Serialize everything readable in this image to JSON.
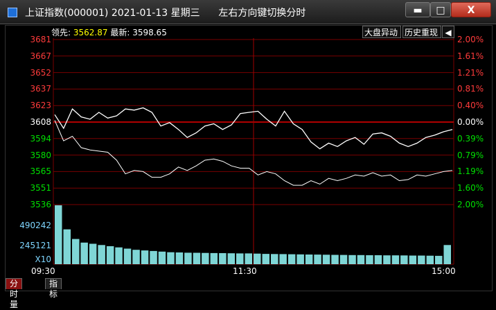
{
  "window": {
    "title": "上证指数(000001) 2021-01-13 星期三      左右方向键切换分时",
    "buttons": {
      "minimize": "▬",
      "maximize": "□",
      "close": "X"
    }
  },
  "info": {
    "lead_label": "领先:",
    "lead_value": "3562.87",
    "latest_label": "最新:",
    "latest_value": "3598.65"
  },
  "toolbar": {
    "market_anomaly": "大盘异动",
    "history_replay": "历史重现",
    "back_icon": "arrow-left-icon"
  },
  "price_axis_left": [
    "3681",
    "3667",
    "3652",
    "3637",
    "3623",
    "3608",
    "3594",
    "3580",
    "3565",
    "3551",
    "3536"
  ],
  "price_axis_right": [
    "2.00%",
    "1.61%",
    "1.21%",
    "0.81%",
    "0.40%",
    "0.00%",
    "0.39%",
    "0.79%",
    "1.19%",
    "1.60%",
    "2.00%"
  ],
  "volume_axis": [
    "490242",
    "245121",
    "X10"
  ],
  "time_axis": [
    "09:30",
    "11:30",
    "15:00"
  ],
  "tabs": [
    "分时量",
    "指标"
  ],
  "colors": {
    "up": "#ff3b3b",
    "down": "#00e000",
    "flat": "#ffffff",
    "grid": "#7a0000",
    "volume": "#7fd6d6"
  },
  "chart_data": {
    "type": "line",
    "x": [
      "09:30",
      "11:30",
      "15:00"
    ],
    "ylim": [
      3536,
      3681
    ],
    "series": [
      {
        "values": [
          3615,
          3603,
          3620,
          3613,
          3611,
          3617,
          3612,
          3614,
          3620,
          3619,
          3621,
          3617,
          3605,
          3608,
          3602,
          3595,
          3599,
          3605,
          3607,
          3602,
          3606,
          3616,
          3617,
          3618,
          3611,
          3605,
          3618,
          3607,
          3602,
          3591,
          3585,
          3590,
          3587,
          3592,
          3595,
          3589,
          3598,
          3599,
          3596,
          3590,
          3587,
          3590,
          3595,
          3597,
          3600,
          3602
        ]
      },
      {
        "values": [
          3610,
          3592,
          3596,
          3586,
          3584,
          3583,
          3582,
          3575,
          3563,
          3566,
          3565,
          3560,
          3560,
          3563,
          3569,
          3566,
          3570,
          3575,
          3576,
          3574,
          3570,
          3568,
          3568,
          3562,
          3565,
          3563,
          3557,
          3553,
          3553,
          3557,
          3554,
          3559,
          3557,
          3559,
          3562,
          3561,
          3564,
          3561,
          3562,
          3557,
          3558,
          3562,
          3561,
          3563,
          3565,
          3566
        ]
      }
    ],
    "volume": [
      490242,
      290000,
      210000,
      180000,
      170000,
      160000,
      150000,
      140000,
      130000,
      120000,
      115000,
      110000,
      105000,
      100000,
      98000,
      96000,
      95000,
      94000,
      93000,
      92000,
      91000,
      90000,
      90000,
      88000,
      86000,
      85000,
      84000,
      83000,
      82000,
      81000,
      80000,
      79000,
      78000,
      77000,
      76000,
      76000,
      75000,
      75000,
      74000,
      74000,
      73000,
      72000,
      72000,
      71000,
      70000,
      160000
    ]
  }
}
